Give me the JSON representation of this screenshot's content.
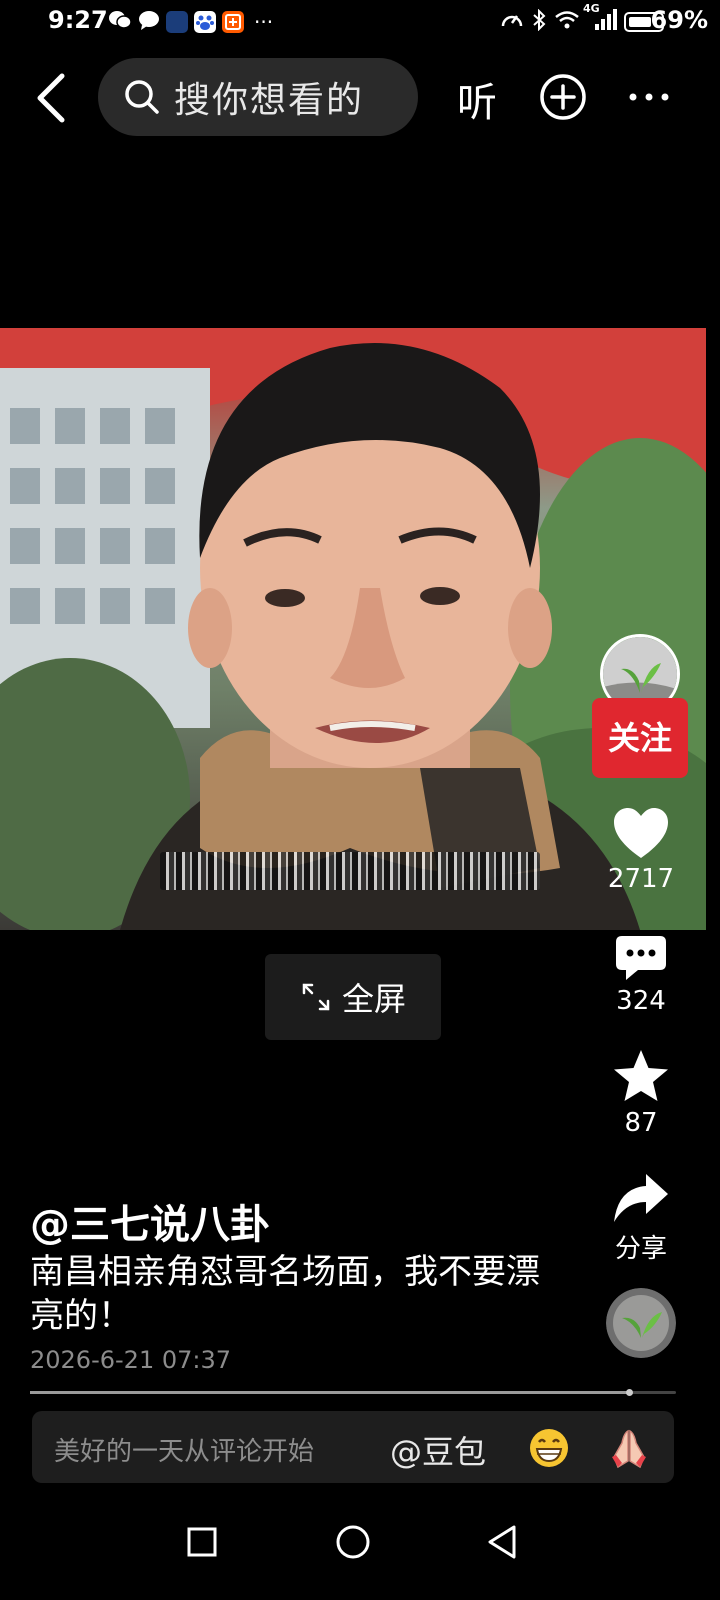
{
  "status_bar": {
    "time": "9:27",
    "network_label": "4G",
    "battery": "69%",
    "more": "···"
  },
  "top_bar": {
    "search_placeholder": "搜你想看的",
    "listen_label": "听"
  },
  "video": {
    "fullscreen_label": "全屏"
  },
  "sidebar": {
    "follow_label": "关注",
    "likes": "2717",
    "comments": "324",
    "favorites": "87",
    "share_label": "分享"
  },
  "post": {
    "author": "@三七说八卦",
    "caption": "南昌相亲角怼哥名场面，我不要漂亮的！",
    "date": "2026-6-21 07:37",
    "progress_fraction": 0.927
  },
  "comment_bar": {
    "placeholder": "美好的一天从评论开始",
    "mention": "@豆包"
  },
  "colors": {
    "follow_red": "#e0272f",
    "background": "#000000"
  }
}
